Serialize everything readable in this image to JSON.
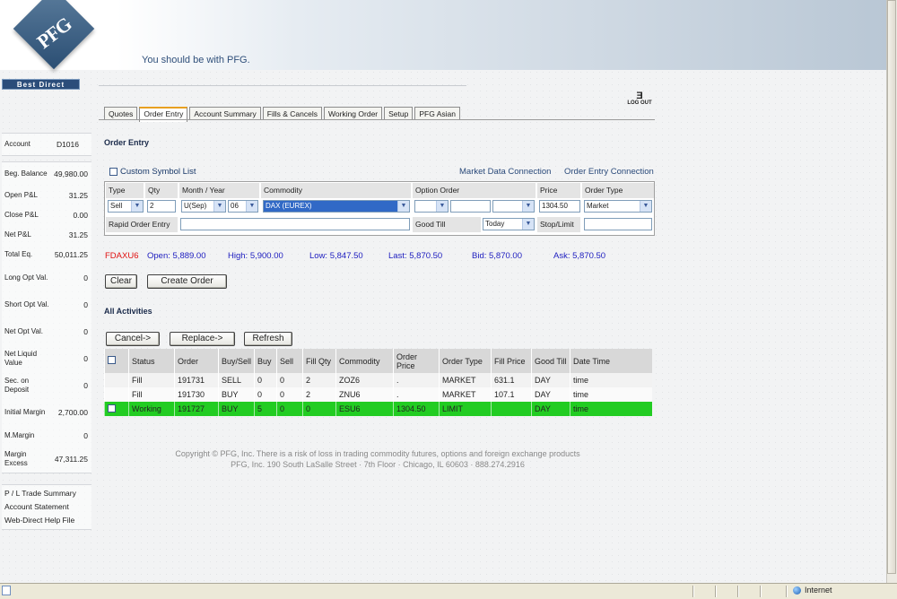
{
  "header": {
    "logo_text": "PFG",
    "tagline": "You should be with PFG.",
    "brand_bar": "Best Direct"
  },
  "logout": "LOG OUT",
  "tabs": [
    "Quotes",
    "Order Entry",
    "Account Summary",
    "Fills & Cancels",
    "Working Order",
    "Setup",
    "PFG Asian"
  ],
  "active_tab": "Order Entry",
  "sidebar": {
    "account": {
      "label": "Account",
      "value": "D1016"
    },
    "rows": [
      {
        "label": "Beg. Balance",
        "value": "49,980.00"
      },
      {
        "label": "Open P&L",
        "value": "31.25"
      },
      {
        "label": "Close P&L",
        "value": "0.00"
      },
      {
        "label": "Net P&L",
        "value": "31.25"
      },
      {
        "label": "Total Eq.",
        "value": "50,011.25"
      },
      {
        "label": "Long Opt Val.",
        "value": "0"
      },
      {
        "label": "Short Opt Val.",
        "value": "0"
      },
      {
        "label": "Net Opt Val.",
        "value": "0"
      },
      {
        "label": "Net Liquid Value",
        "value": "0"
      },
      {
        "label": "Sec. on Deposit",
        "value": "0"
      },
      {
        "label": "Initial Margin",
        "value": "2,700.00"
      },
      {
        "label": "M.Margin",
        "value": "0"
      },
      {
        "label": "Margin Excess",
        "value": "47,311.25"
      }
    ],
    "links": [
      "P / L Trade Summary",
      "Account    Statement",
      "Web-Direct Help File"
    ]
  },
  "order_entry": {
    "title": "Order Entry",
    "custom_symbol_list": "Custom Symbol List",
    "market_data_connection": "Market Data Connection",
    "order_entry_connection": "Order Entry Connection",
    "headers": {
      "type": "Type",
      "qty": "Qty",
      "month_year": "Month / Year",
      "commodity": "Commodity",
      "option_order": "Option Order",
      "price": "Price",
      "order_type": "Order Type"
    },
    "values": {
      "type": "Sell",
      "qty": "2",
      "month": "U(Sep)",
      "year": "06",
      "commodity": "DAX (EUREX)",
      "price": "1304.50",
      "order_type": "Market",
      "good_till": "Today"
    },
    "labels": {
      "rapid_order_entry": "Rapid Order Entry",
      "good_till": "Good Till",
      "stop_limit": "Stop/Limit"
    }
  },
  "quote": {
    "symbol": "FDAXU6",
    "open": "Open: 5,889.00",
    "high": "High: 5,900.00",
    "low": "Low: 5,847.50",
    "last": "Last: 5,870.50",
    "bid": "Bid: 5,870.00",
    "ask": "Ask: 5,870.50"
  },
  "buttons": {
    "clear": "Clear",
    "create_order": "Create Order",
    "cancel": "Cancel->",
    "replace": "Replace->",
    "refresh": "Refresh"
  },
  "activities": {
    "title": "All Activities",
    "columns": [
      "",
      "Status",
      "Order",
      "Buy/Sell",
      "Buy",
      "Sell",
      "Fill Qty",
      "Commodity",
      "Order Price",
      "Order Type",
      "Fill Price",
      "Good Till",
      "Date Time"
    ],
    "rows": [
      {
        "checkbox": false,
        "status": "Fill",
        "order": "191731",
        "buy_sell": "SELL",
        "buy": "0",
        "sell": "0",
        "fill_qty": "2",
        "commodity": "ZOZ6",
        "order_price": ".",
        "order_type": "MARKET",
        "fill_price": "631.1",
        "good_till": "DAY",
        "date_time": "time"
      },
      {
        "checkbox": false,
        "status": "Fill",
        "order": "191730",
        "buy_sell": "BUY",
        "buy": "0",
        "sell": "0",
        "fill_qty": "2",
        "commodity": "ZNU6",
        "order_price": ".",
        "order_type": "MARKET",
        "fill_price": "107.1",
        "good_till": "DAY",
        "date_time": "time"
      },
      {
        "checkbox": true,
        "status": "Working",
        "order": "191727",
        "buy_sell": "BUY",
        "buy": "5",
        "sell": "0",
        "fill_qty": "0",
        "commodity": "ESU6",
        "order_price": "1304.50",
        "order_type": "LIMIT",
        "fill_price": "",
        "good_till": "DAY",
        "date_time": "time"
      }
    ]
  },
  "footer": {
    "line1": "Copyright © PFG, Inc.  There is a risk of loss in trading commodity futures, options and foreign exchange products",
    "line2": "PFG, Inc.    190 South LaSalle Street · 7th Floor · Chicago, IL 60603 · 888.274.2916"
  },
  "statusbar": {
    "zone": "Internet"
  },
  "colors": {
    "working_row": "#22cc22",
    "symbol": "#e01010",
    "quote_text": "#2020c0",
    "brand_bar": "#2b4d7a"
  }
}
